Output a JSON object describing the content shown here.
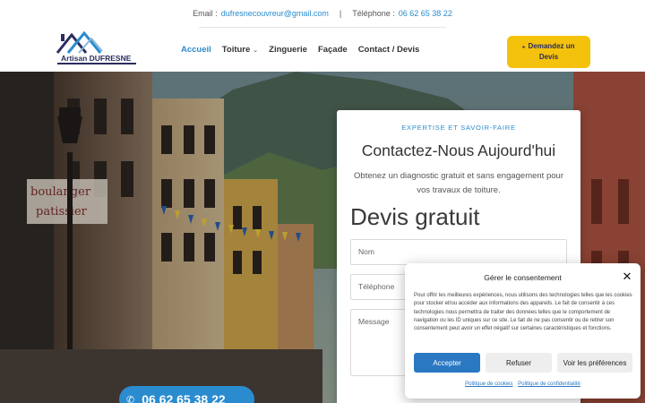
{
  "topbar": {
    "email_prefix": "Email :",
    "email": "dufresnecouvreur@gmail.com",
    "separator": "|",
    "phone_prefix": "Téléphone :",
    "phone": "06 62 65 38 22"
  },
  "logo": {
    "brand": "Artisan DUFRESNE"
  },
  "nav": {
    "items": [
      {
        "label": "Accueil"
      },
      {
        "label": "Toiture"
      },
      {
        "label": "Zinguerie"
      },
      {
        "label": "Façade"
      },
      {
        "label": "Contact / Devis"
      }
    ]
  },
  "cta": {
    "label": "Demandez un Devis"
  },
  "form": {
    "eyebrow": "EXPERTISE ET SAVOIR-FAIRE",
    "title": "Contactez-Nous Aujourd'hui",
    "subtitle": "Obtenez un diagnostic gratuit et sans engagement pour vos travaux de toiture.",
    "heading": "Devis gratuit",
    "fields": {
      "nom_placeholder": "Nom",
      "tel_placeholder": "Téléphone",
      "msg_placeholder": "Message"
    }
  },
  "hero": {
    "shop_sign_line1": "boulanger",
    "shop_sign_line2": "patissier",
    "phone_pill": "06 62 65 38 22"
  },
  "cookie": {
    "title": "Gérer le consentement",
    "body": "Pour offrir les meilleures expériences, nous utilisons des technologies telles que les cookies pour stocker et/ou accéder aux informations des appareils. Le fait de consentir à ces technologies nous permettra de traiter des données telles que le comportement de navigation ou les ID uniques sur ce site. Le fait de ne pas consentir ou de retirer son consentement peut avoir un effet négatif sur certaines caractéristiques et fonctions.",
    "accept": "Accepter",
    "deny": "Refuser",
    "prefs": "Voir les préférences",
    "link_cookies": "Politique de cookies",
    "link_privacy": "Politique de confidentialité"
  },
  "colors": {
    "accent": "#2a8ccf",
    "cta_yellow": "#f4c20d",
    "brand_navy": "#2b2d5e",
    "cookie_blue": "#2a78c2"
  }
}
